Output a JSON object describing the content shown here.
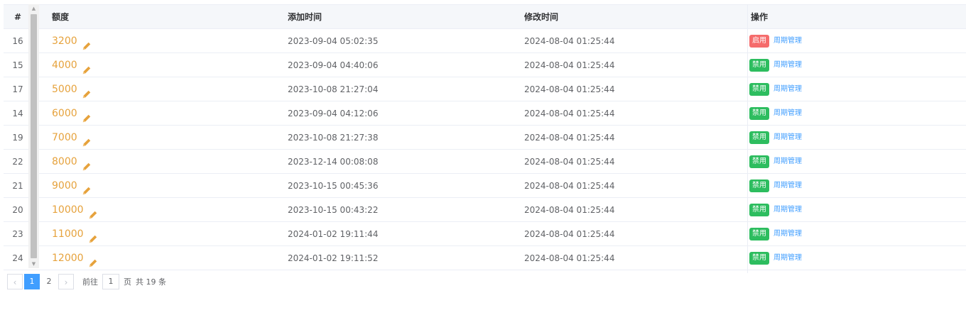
{
  "table": {
    "headers": {
      "index": "#",
      "amount": "额度",
      "added": "添加时间",
      "modified": "修改时间",
      "actions": "操作"
    },
    "rows": [
      {
        "id": "16",
        "amount": "3200",
        "added": "2023-09-04 05:02:35",
        "modified": "2024-08-04 01:25:44",
        "status_label": "启用",
        "status_color": "#f56c6c",
        "manage_label": "周期管理"
      },
      {
        "id": "15",
        "amount": "4000",
        "added": "2023-09-04 04:40:06",
        "modified": "2024-08-04 01:25:44",
        "status_label": "禁用",
        "status_color": "#2dbd5f",
        "manage_label": "周期管理"
      },
      {
        "id": "17",
        "amount": "5000",
        "added": "2023-10-08 21:27:04",
        "modified": "2024-08-04 01:25:44",
        "status_label": "禁用",
        "status_color": "#2dbd5f",
        "manage_label": "周期管理"
      },
      {
        "id": "14",
        "amount": "6000",
        "added": "2023-09-04 04:12:06",
        "modified": "2024-08-04 01:25:44",
        "status_label": "禁用",
        "status_color": "#2dbd5f",
        "manage_label": "周期管理"
      },
      {
        "id": "19",
        "amount": "7000",
        "added": "2023-10-08 21:27:38",
        "modified": "2024-08-04 01:25:44",
        "status_label": "禁用",
        "status_color": "#2dbd5f",
        "manage_label": "周期管理"
      },
      {
        "id": "22",
        "amount": "8000",
        "added": "2023-12-14 00:08:08",
        "modified": "2024-08-04 01:25:44",
        "status_label": "禁用",
        "status_color": "#2dbd5f",
        "manage_label": "周期管理"
      },
      {
        "id": "21",
        "amount": "9000",
        "added": "2023-10-15 00:45:36",
        "modified": "2024-08-04 01:25:44",
        "status_label": "禁用",
        "status_color": "#2dbd5f",
        "manage_label": "周期管理"
      },
      {
        "id": "20",
        "amount": "10000",
        "added": "2023-10-15 00:43:22",
        "modified": "2024-08-04 01:25:44",
        "status_label": "禁用",
        "status_color": "#2dbd5f",
        "manage_label": "周期管理"
      },
      {
        "id": "23",
        "amount": "11000",
        "added": "2024-01-02 19:11:44",
        "modified": "2024-08-04 01:25:44",
        "status_label": "禁用",
        "status_color": "#2dbd5f",
        "manage_label": "周期管理"
      },
      {
        "id": "24",
        "amount": "12000",
        "added": "2024-01-02 19:11:52",
        "modified": "2024-08-04 01:25:44",
        "status_label": "禁用",
        "status_color": "#2dbd5f",
        "manage_label": "周期管理"
      }
    ]
  },
  "pagination": {
    "prev_icon": "chevron-left-icon",
    "pages": [
      "1",
      "2"
    ],
    "active_page": "1",
    "next_icon": "chevron-right-icon",
    "goto_label": "前往",
    "goto_value": "1",
    "page_suffix": "页",
    "total_label": "共 19 条"
  },
  "colors": {
    "accent": "#409eff",
    "amount": "#e6a23c",
    "enabled_tag": "#f56c6c",
    "disabled_tag": "#2dbd5f"
  }
}
